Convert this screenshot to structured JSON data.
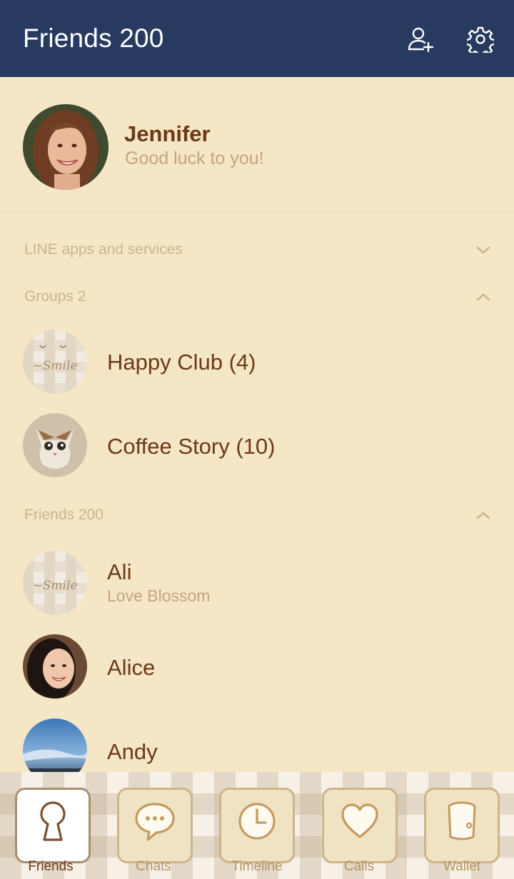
{
  "header": {
    "title": "Friends 200",
    "add_friend_icon": "add-friend-icon",
    "settings_icon": "gear-icon"
  },
  "profile": {
    "name": "Jennifer",
    "status": "Good luck to you!"
  },
  "sections": {
    "services": {
      "label": "LINE apps and services",
      "state": "collapsed"
    },
    "groups": {
      "label": "Groups 2",
      "state": "expanded"
    },
    "friends": {
      "label": "Friends 200",
      "state": "expanded"
    }
  },
  "groups": [
    {
      "name": "Happy Club (4)"
    },
    {
      "name": "Coffee Story (10)"
    }
  ],
  "friends": [
    {
      "name": "Ali",
      "status": "Love Blossom"
    },
    {
      "name": "Alice",
      "status": ""
    },
    {
      "name": "Andy",
      "status": ""
    }
  ],
  "tabs": [
    {
      "label": "Friends",
      "icon": "keyhole-icon",
      "active": true
    },
    {
      "label": "Chats",
      "icon": "speech-bubble-icon",
      "active": false
    },
    {
      "label": "Timeline",
      "icon": "clock-icon",
      "active": false
    },
    {
      "label": "Calls",
      "icon": "heart-icon",
      "active": false
    },
    {
      "label": "Wallet",
      "icon": "cup-icon",
      "active": false
    }
  ],
  "colors": {
    "header_bg": "#283a5f",
    "body_bg": "#f5e6c6",
    "name_text": "#6b3a17",
    "secondary_text": "#c4a482"
  }
}
